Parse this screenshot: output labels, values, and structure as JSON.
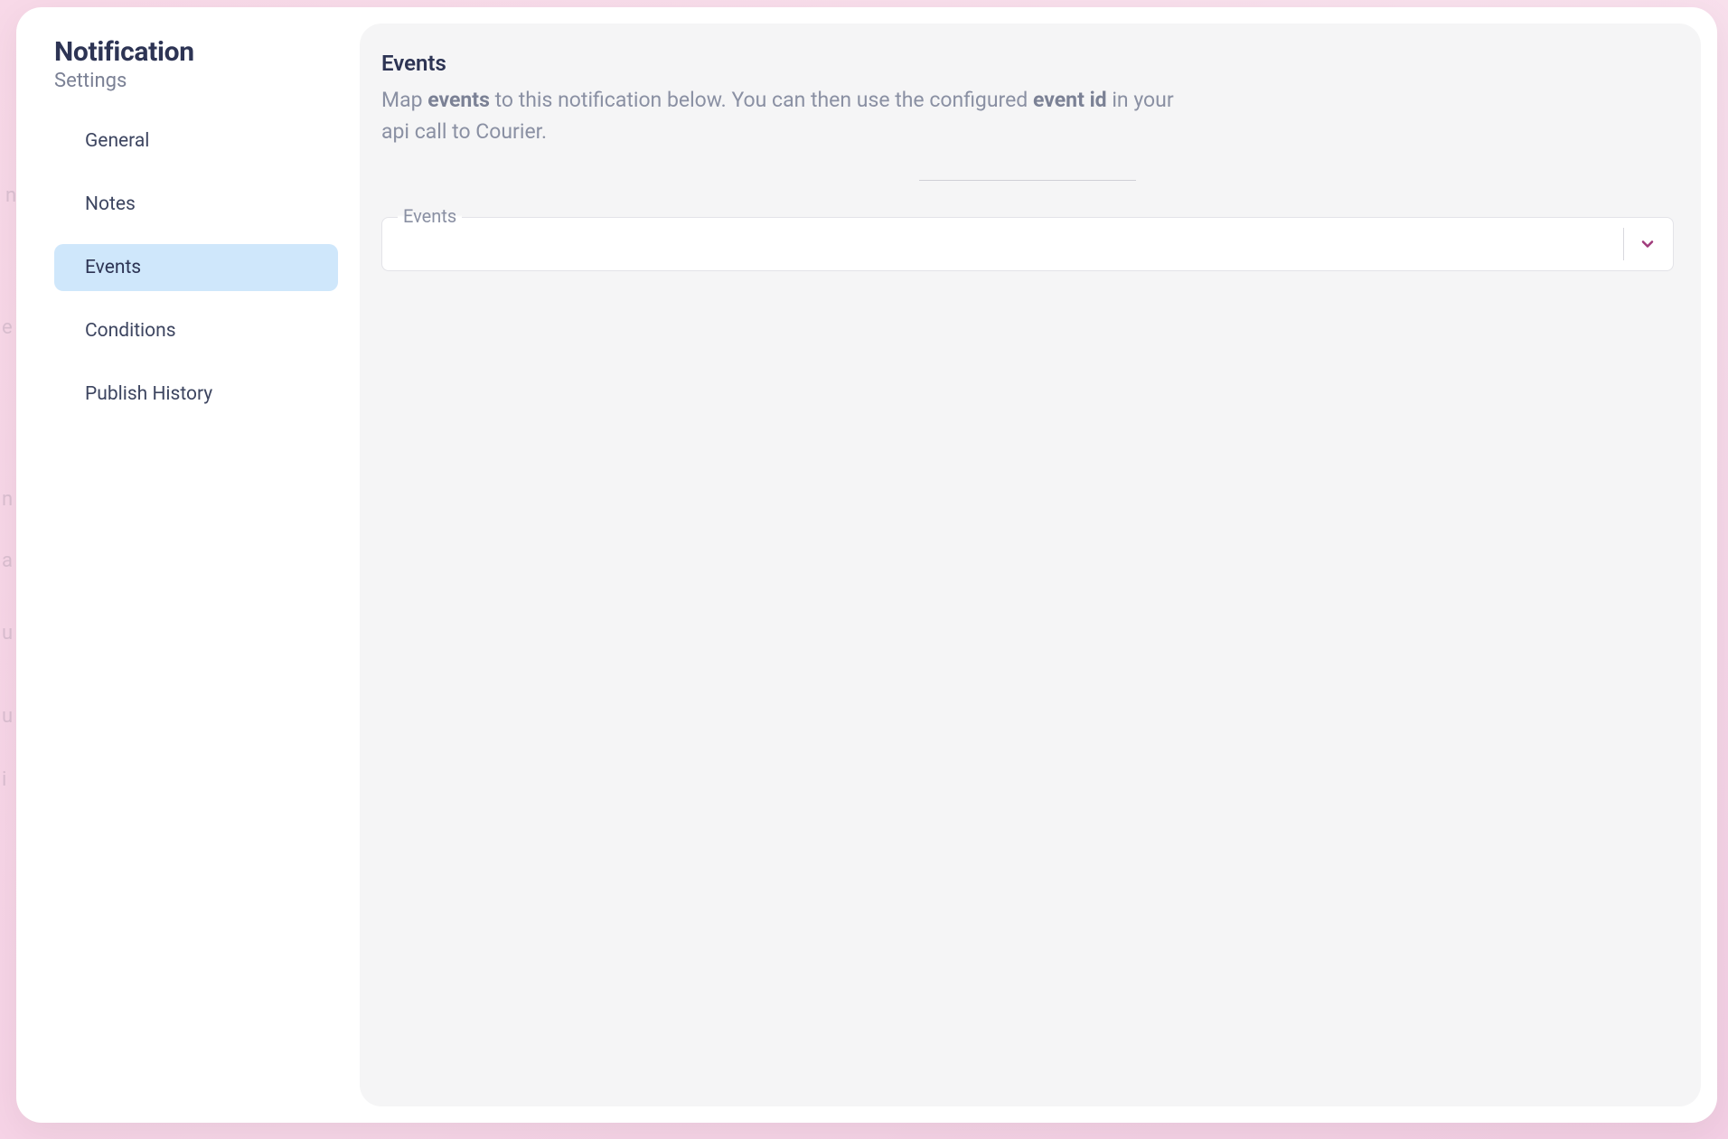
{
  "sidebar": {
    "title": "Notification",
    "subtitle": "Settings",
    "items": [
      {
        "label": "General",
        "active": false
      },
      {
        "label": "Notes",
        "active": false
      },
      {
        "label": "Events",
        "active": true
      },
      {
        "label": "Conditions",
        "active": false
      },
      {
        "label": "Publish History",
        "active": false
      }
    ]
  },
  "content": {
    "title": "Events",
    "desc_prefix": "Map ",
    "desc_strong1": "events",
    "desc_mid": " to this notification below. You can then use the configured ",
    "desc_strong2": "event id",
    "desc_suffix": " in your api call to Courier.",
    "field_label": "Events",
    "select_value": ""
  },
  "colors": {
    "accent": "#a03b7b",
    "nav_active_bg": "#cfe7fb",
    "text_primary": "#2d3454",
    "text_muted": "#8a90a3"
  }
}
